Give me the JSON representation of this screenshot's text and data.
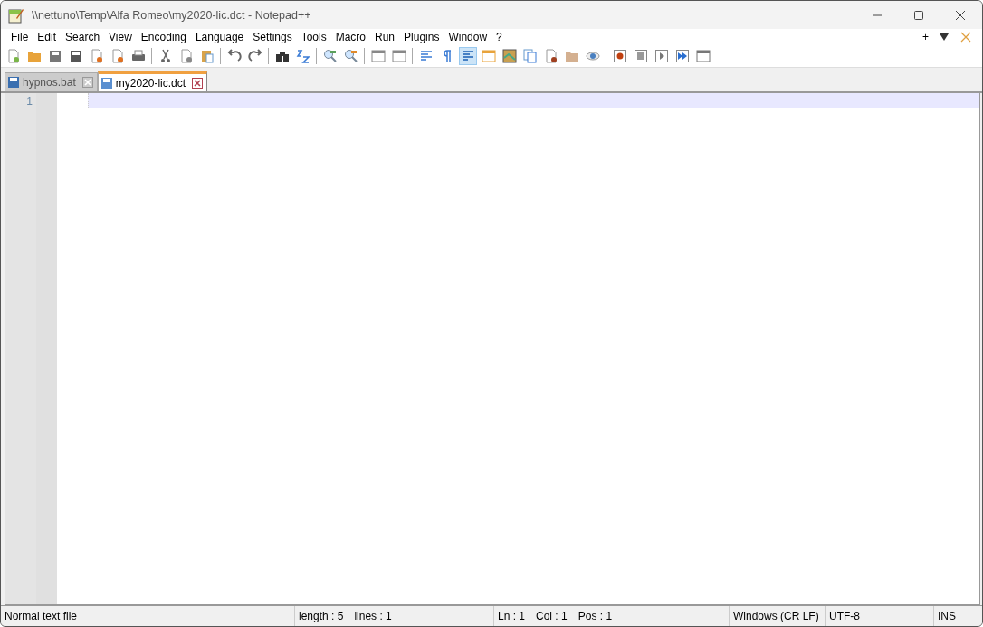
{
  "window": {
    "title": "\\\\nettuno\\Temp\\Alfa Romeo\\my2020-lic.dct - Notepad++"
  },
  "menu": [
    "File",
    "Edit",
    "Search",
    "View",
    "Encoding",
    "Language",
    "Settings",
    "Tools",
    "Macro",
    "Run",
    "Plugins",
    "Window",
    "?"
  ],
  "menu_right": [
    "+"
  ],
  "toolbar_groups": [
    [
      {
        "pressed": false
      },
      {
        "pressed": false
      },
      {
        "pressed": false
      },
      {
        "pressed": false
      },
      {
        "pressed": false
      },
      {
        "pressed": false
      },
      {
        "pressed": false
      }
    ],
    [
      {
        "pressed": false
      },
      {
        "pressed": false
      },
      {
        "pressed": false
      }
    ],
    [
      {
        "pressed": false
      },
      {
        "pressed": false
      }
    ],
    [
      {
        "pressed": false
      },
      {
        "pressed": false
      }
    ],
    [
      {
        "pressed": false
      },
      {
        "pressed": false
      }
    ],
    [
      {
        "pressed": false
      },
      {
        "pressed": false
      }
    ],
    [
      {
        "pressed": false
      },
      {
        "pressed": false
      },
      {
        "pressed": true
      },
      {
        "pressed": false
      },
      {
        "pressed": false
      },
      {
        "pressed": false
      },
      {
        "pressed": false
      },
      {
        "pressed": false
      },
      {
        "pressed": false
      }
    ],
    [
      {
        "pressed": false
      },
      {
        "pressed": false
      },
      {
        "pressed": false
      },
      {
        "pressed": false
      },
      {
        "pressed": false
      }
    ]
  ],
  "tabs": [
    {
      "label": "hypnos.bat",
      "selected": false
    },
    {
      "label": "my2020-lic.dct",
      "selected": true
    }
  ],
  "editor": {
    "line_numbers": [
      "1"
    ]
  },
  "status_bar": {
    "file_type": "Normal text file",
    "length": "length : 5",
    "lines": "lines : 1",
    "ln": "Ln : 1",
    "col": "Col : 1",
    "pos": "Pos : 1",
    "eol": "Windows (CR LF)",
    "encoding": "UTF-8",
    "mode": "INS"
  }
}
